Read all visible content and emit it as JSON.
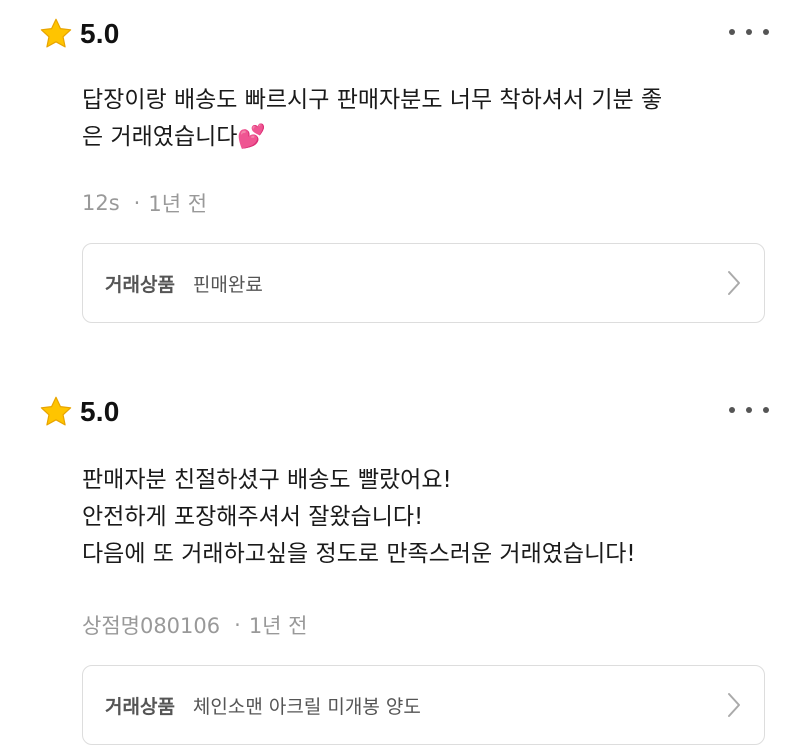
{
  "colors": {
    "star": "#FFC400",
    "star_outline": "#E8A400",
    "meta_text": "#999999",
    "border": "#dddddd"
  },
  "reviews": [
    {
      "rating": "5.0",
      "text": "답장이랑 배송도 빠르시구 판매자분도 너무 착하셔서 기분 좋\n은 거래였습니다💕",
      "author": "12s",
      "separator": "·",
      "time": "1년 전",
      "product_label": "거래상품",
      "product_name": "핀매완료",
      "icons": [
        "star-icon",
        "more-icon",
        "chevron-right-icon"
      ]
    },
    {
      "rating": "5.0",
      "text": "판매자분 친절하셨구 배송도 빨랐어요!\n안전하게 포장해주셔서 잘왔습니다!\n다음에 또 거래하고싶을 정도로 만족스러운 거래였습니다!",
      "author": "상점명080106",
      "separator": "·",
      "time": "1년 전",
      "product_label": "거래상품",
      "product_name": "체인소맨 아크릴 미개봉 양도",
      "icons": [
        "star-icon",
        "more-icon",
        "chevron-right-icon"
      ]
    }
  ]
}
